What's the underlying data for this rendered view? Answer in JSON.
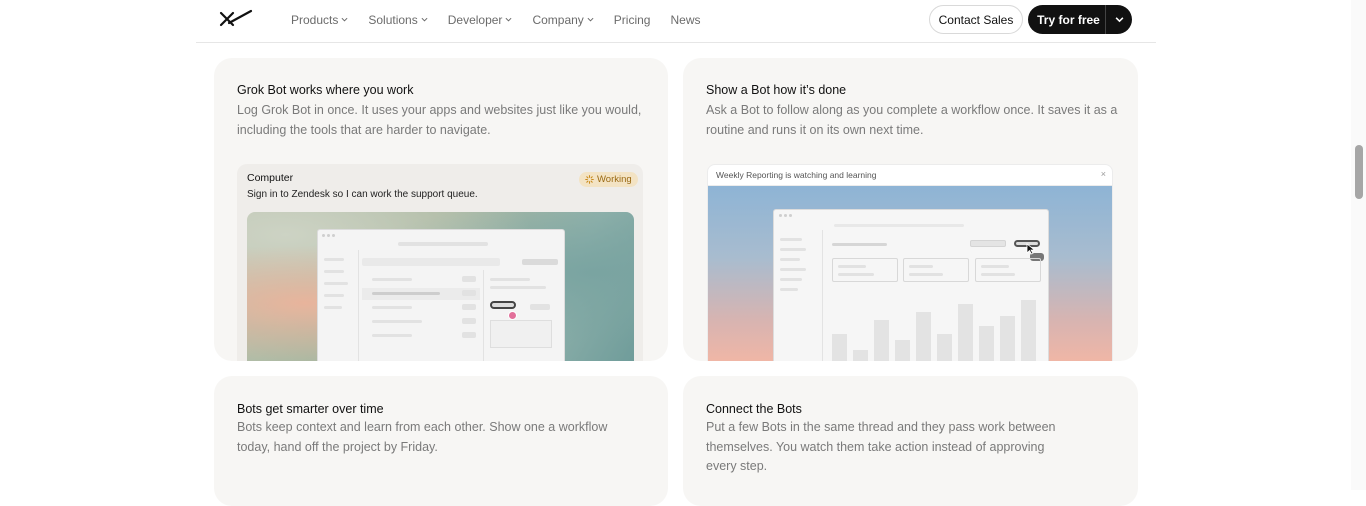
{
  "header": {
    "logo_icon": "x-logo-icon",
    "nav": [
      {
        "label": "Products",
        "has_dropdown": true
      },
      {
        "label": "Solutions",
        "has_dropdown": true
      },
      {
        "label": "Developer",
        "has_dropdown": true
      },
      {
        "label": "Company",
        "has_dropdown": true
      },
      {
        "label": "Pricing",
        "has_dropdown": false
      },
      {
        "label": "News",
        "has_dropdown": false
      }
    ],
    "contact_label": "Contact Sales",
    "try_label": "Try for free"
  },
  "cards": [
    {
      "title": "Grok Bot works where you work",
      "body": "Log Grok Bot in once. It uses your apps and websites just like you would, including the tools that are harder to navigate.",
      "preview": {
        "title": "Computer",
        "subtitle": "Sign in to Zendesk so I can work the support queue.",
        "badge": "Working",
        "badge_color": "#9b6a14"
      }
    },
    {
      "title": "Show a Bot how it’s done",
      "body": "Ask a Bot to follow along as you complete a workflow once. It saves it as a routine and runs it on its own next time.",
      "preview": {
        "banner": "Weekly Reporting is watching and learning",
        "close": "×"
      }
    },
    {
      "title": "Bots get smarter over time",
      "body": "Bots keep context and learn from each other. Show one a workflow today, hand off the project by Friday."
    },
    {
      "title": "Connect the Bots",
      "body": "Put a few Bots in the same thread and they pass work between themselves. You watch them take action instead of approving every step."
    }
  ]
}
